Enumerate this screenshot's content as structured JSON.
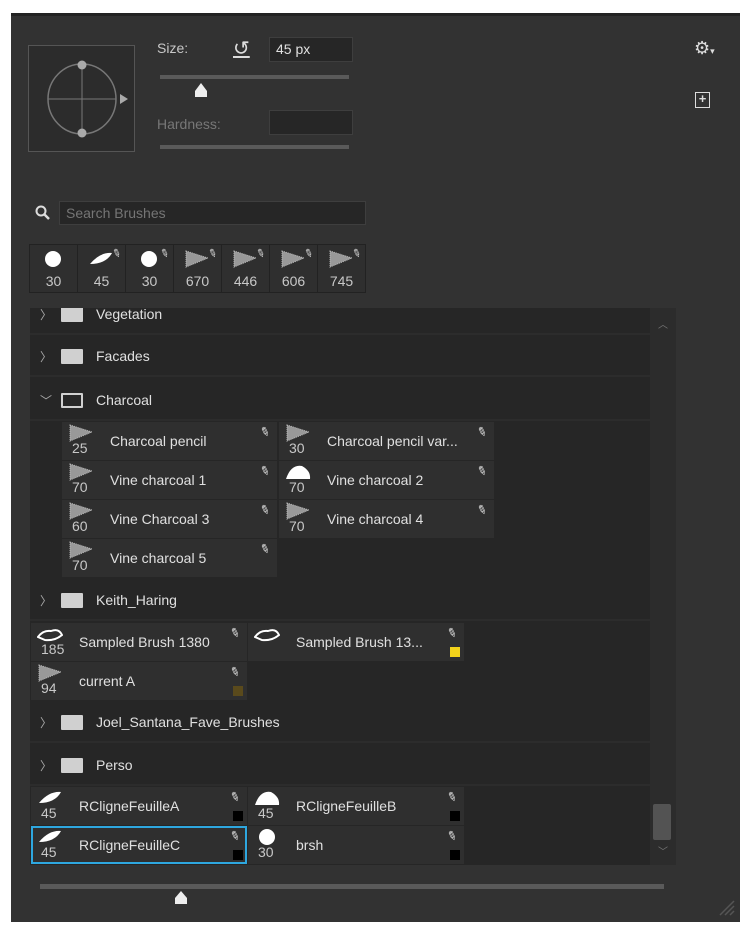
{
  "brush_settings": {
    "size_label": "Size:",
    "size_value": "45 px",
    "size_slider_fraction": 0.22,
    "hardness_label": "Hardness:",
    "hardness_value": ""
  },
  "search": {
    "placeholder": "Search Brushes"
  },
  "recent_brushes": [
    {
      "size": "30",
      "tip": "round-hard"
    },
    {
      "size": "45",
      "tip": "leaf"
    },
    {
      "size": "30",
      "tip": "round-hard"
    },
    {
      "size": "670",
      "tip": "textured"
    },
    {
      "size": "446",
      "tip": "textured"
    },
    {
      "size": "606",
      "tip": "textured"
    },
    {
      "size": "745",
      "tip": "textured"
    }
  ],
  "list": {
    "folders": {
      "vegetation": "Vegetation",
      "facades": "Facades",
      "charcoal": "Charcoal",
      "keith": "Keith_Haring",
      "joel": "Joel_Santana_Fave_Brushes",
      "perso": "Perso"
    },
    "charcoal_brushes": [
      {
        "name": "Charcoal pencil",
        "size": "25",
        "tip": "textured"
      },
      {
        "name": "Charcoal pencil var...",
        "size": "30",
        "tip": "textured"
      },
      {
        "name": "Vine charcoal 1",
        "size": "70",
        "tip": "textured"
      },
      {
        "name": "Vine charcoal 2",
        "size": "70",
        "tip": "blob"
      },
      {
        "name": "Vine Charcoal 3",
        "size": "60",
        "tip": "textured"
      },
      {
        "name": "Vine charcoal 4",
        "size": "70",
        "tip": "textured"
      },
      {
        "name": "Vine charcoal 5",
        "size": "70",
        "tip": "textured"
      }
    ],
    "loose_brushes": [
      {
        "name": "Sampled Brush 1380",
        "size": "185",
        "tip": "cloud"
      },
      {
        "name": "Sampled Brush 13...",
        "size": "",
        "tip": "cloud",
        "swatch": "#f2d21b"
      },
      {
        "name": "current A",
        "size": "94",
        "tip": "textured",
        "swatch": "#5a4a1c"
      }
    ],
    "perso_brushes": [
      {
        "name": "RCligneFeuilleA",
        "size": "45",
        "tip": "leaf",
        "swatch": "#000000"
      },
      {
        "name": "RCligneFeuilleB",
        "size": "45",
        "tip": "blob",
        "swatch": "#000000"
      },
      {
        "name": "RCligneFeuilleC",
        "size": "45",
        "tip": "leaf",
        "swatch": "#000000",
        "selected": true
      },
      {
        "name": "brsh",
        "size": "30",
        "tip": "round-hard",
        "swatch": "#000000"
      }
    ]
  },
  "preview_size_slider_fraction": 0.23,
  "colors": {
    "selection": "#2ea7df",
    "panel": "#323232"
  }
}
